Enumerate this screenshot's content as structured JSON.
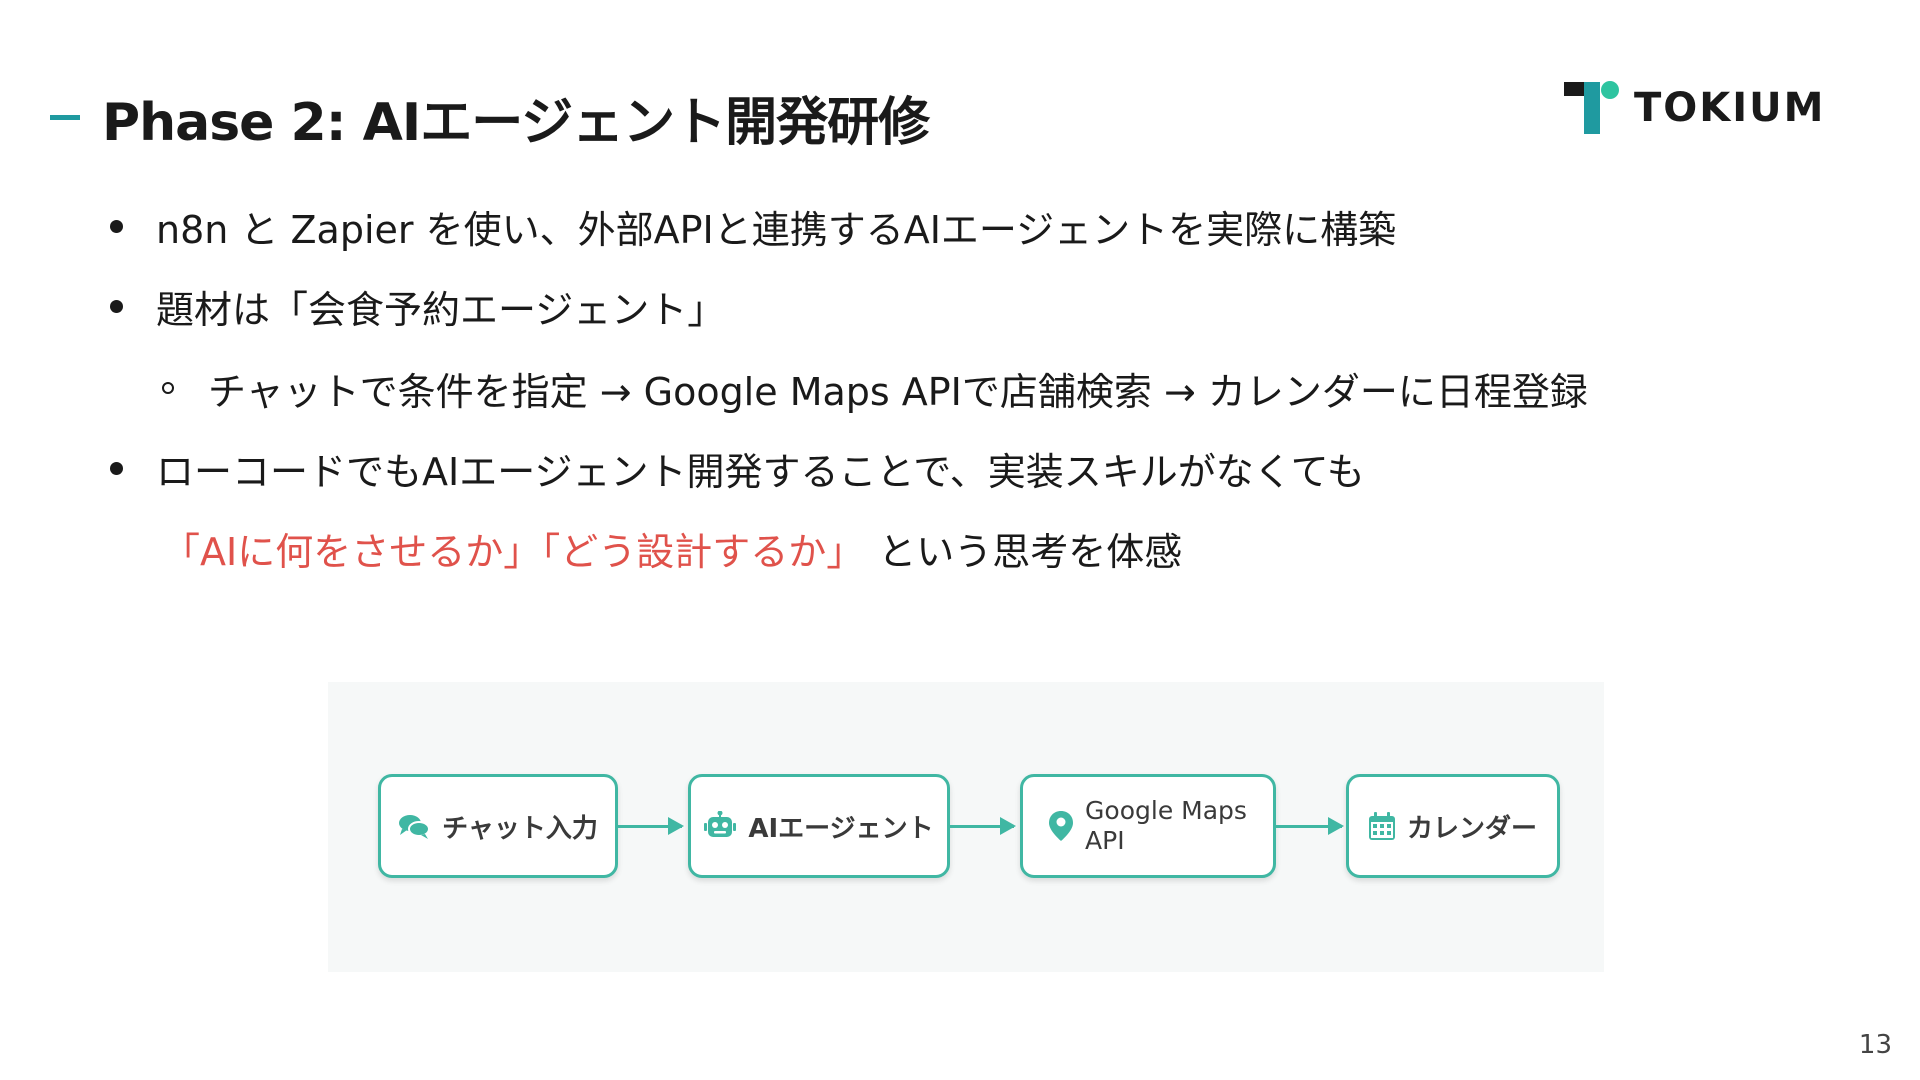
{
  "header": {
    "title": "Phase 2: AIエージェント開発研修",
    "logo_text": "TOKIUM"
  },
  "bullets": [
    {
      "text": "n8n と Zapier を使い、外部APIと連携するAIエージェントを実際に構築"
    },
    {
      "text": "題材は「会食予約エージェント」"
    },
    {
      "text": "チャットで条件を指定 → Google Maps APIで店舗検索 → カレンダーに日程登録"
    },
    {
      "text": "ローコードでもAIエージェント開発することで、実装スキルがなくても"
    },
    {
      "highlight": "「AIに何をさせるか」「どう設計するか」",
      "text": "という思考を体感"
    }
  ],
  "diagram": {
    "nodes": [
      {
        "label": "チャット入力",
        "icon": "chat-icon"
      },
      {
        "label": "AIエージェント",
        "icon": "robot-icon"
      },
      {
        "label_line1": "Google Maps",
        "label_line2": "API",
        "icon": "map-pin-icon"
      },
      {
        "label": "カレンダー",
        "icon": "calendar-icon"
      }
    ]
  },
  "page_number": "13",
  "colors": {
    "accent": "#1f9aa0",
    "node_border": "#40b7a3",
    "highlight": "#e0524b"
  }
}
